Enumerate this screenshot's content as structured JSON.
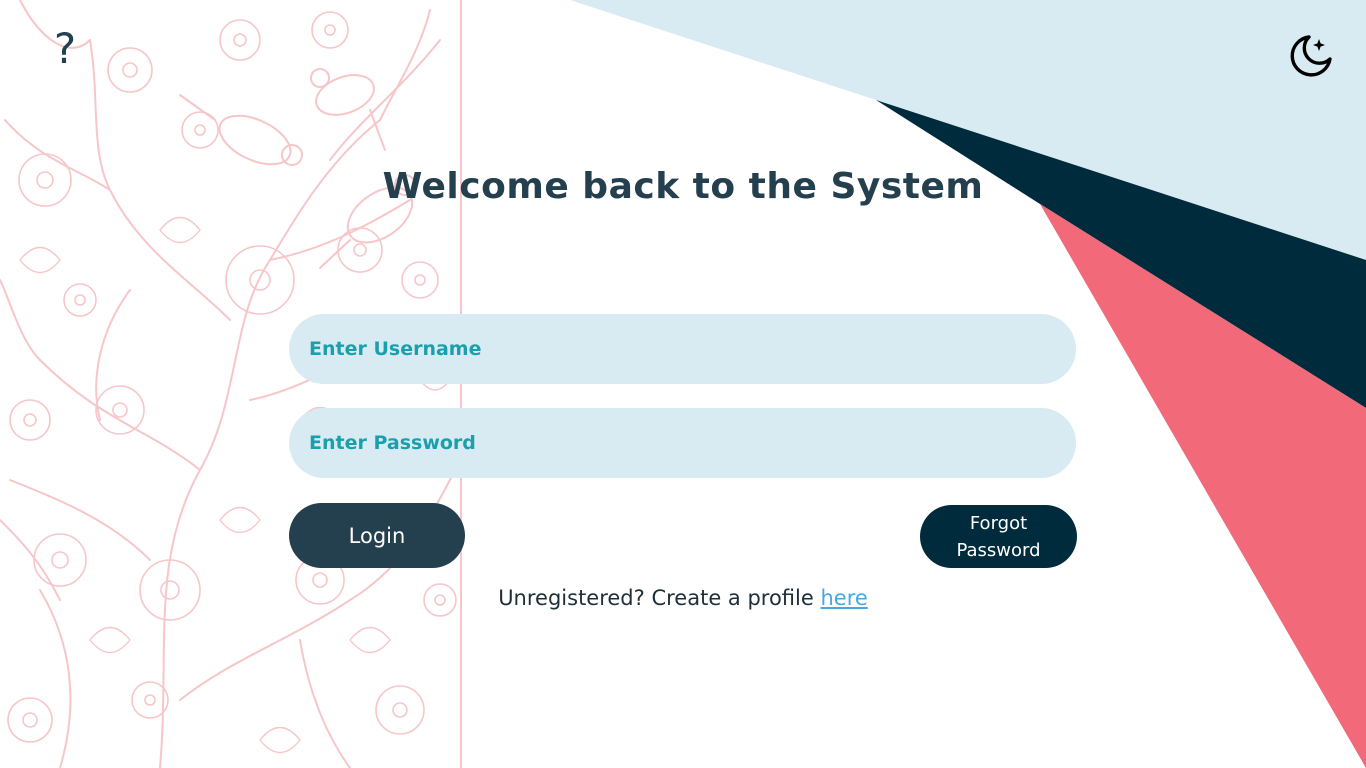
{
  "header": {
    "help_icon": "help-question-icon",
    "help_glyph": "?",
    "theme_icon": "moon-stars-icon"
  },
  "main": {
    "title": "Welcome back to the System",
    "username_placeholder": "Enter Username",
    "password_placeholder": "Enter Password",
    "login_label": "Login",
    "forgot_label_line1": "Forgot",
    "forgot_label_line2": "Password",
    "register_prefix": "Unregistered? Create a profile ",
    "register_link": "here"
  },
  "colors": {
    "primary_dark": "#243f4d",
    "navy": "#002b3d",
    "light_blue": "#d9ebf2",
    "coral": "#f26a79",
    "teal_text": "#1aa0ad",
    "link": "#4aa8e0",
    "floral_pink": "#f6c6c9"
  }
}
